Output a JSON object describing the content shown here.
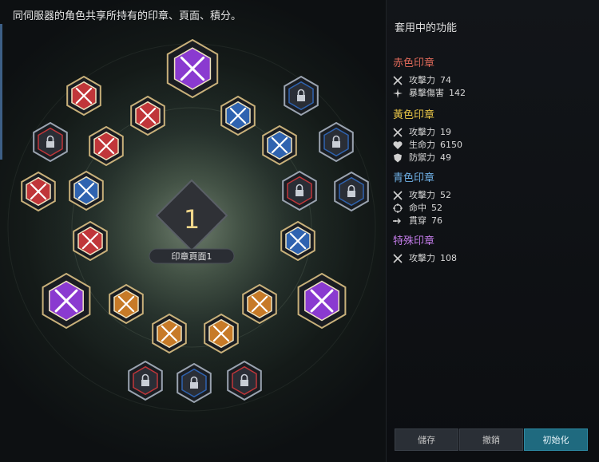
{
  "header": {
    "description": "同伺服器的角色共享所持有的印章、頁面、積分。"
  },
  "center": {
    "page_number": "1",
    "page_label": "印章頁面1"
  },
  "panel": {
    "title": "套用中的功能",
    "sections": [
      {
        "title": "赤色印章",
        "color": "#e06a5a",
        "stats": [
          {
            "icon": "crossed-swords-icon",
            "name": "攻擊力",
            "value": "74"
          },
          {
            "icon": "critical-icon",
            "name": "暴擊傷害",
            "value": "142"
          }
        ]
      },
      {
        "title": "黃色印章",
        "color": "#e8c547",
        "stats": [
          {
            "icon": "crossed-swords-icon",
            "name": "攻擊力",
            "value": "19"
          },
          {
            "icon": "heart-icon",
            "name": "生命力",
            "value": "6150"
          },
          {
            "icon": "shield-icon",
            "name": "防禦力",
            "value": "49"
          }
        ]
      },
      {
        "title": "青色印章",
        "color": "#6fb0e6",
        "stats": [
          {
            "icon": "crossed-swords-icon",
            "name": "攻擊力",
            "value": "52"
          },
          {
            "icon": "crosshair-icon",
            "name": "命中",
            "value": "52"
          },
          {
            "icon": "pierce-icon",
            "name": "貫穿",
            "value": "76"
          }
        ]
      },
      {
        "title": "特殊印章",
        "color": "#c27be8",
        "stats": [
          {
            "icon": "crossed-swords-icon",
            "name": "攻擊力",
            "value": "108"
          }
        ]
      }
    ]
  },
  "buttons": {
    "save": "儲存",
    "unlock": "撤銷",
    "reset": "初始化"
  },
  "colors": {
    "red": "#c0363a",
    "orange": "#c77a28",
    "blue": "#2f63b0",
    "purple": "#8a3ad0",
    "locked": "#3b3f48"
  },
  "slots": [
    {
      "name": "special",
      "kind": "special",
      "color": "purple"
    },
    {
      "name": "red",
      "kind": "sword",
      "color": "red"
    },
    {
      "name": "red",
      "kind": "sword",
      "color": "red"
    },
    {
      "name": "blue",
      "kind": "sword",
      "color": "blue"
    },
    {
      "name": "locked",
      "kind": "lock",
      "color": "blue"
    },
    {
      "name": "locked",
      "kind": "lock",
      "color": "red"
    },
    {
      "name": "red",
      "kind": "sword",
      "color": "red"
    },
    {
      "name": "blue",
      "kind": "sword",
      "color": "blue"
    },
    {
      "name": "locked",
      "kind": "lock",
      "color": "blue"
    },
    {
      "name": "red",
      "kind": "sword",
      "color": "red"
    },
    {
      "name": "blue",
      "kind": "sword",
      "color": "blue"
    },
    {
      "name": "locked",
      "kind": "lock",
      "color": "red"
    },
    {
      "name": "locked",
      "kind": "lock",
      "color": "blue"
    },
    {
      "name": "red",
      "kind": "sword",
      "color": "red"
    },
    {
      "name": "blue",
      "kind": "sword",
      "color": "blue"
    },
    {
      "name": "special",
      "kind": "special",
      "color": "purple"
    },
    {
      "name": "special",
      "kind": "special",
      "color": "purple"
    },
    {
      "name": "orange",
      "kind": "sword",
      "color": "orange"
    },
    {
      "name": "orange",
      "kind": "sword",
      "color": "orange"
    },
    {
      "name": "orange",
      "kind": "sword",
      "color": "orange"
    },
    {
      "name": "orange",
      "kind": "sword",
      "color": "orange"
    },
    {
      "name": "locked",
      "kind": "lock",
      "color": "red"
    },
    {
      "name": "locked",
      "kind": "lock",
      "color": "blue"
    },
    {
      "name": "locked",
      "kind": "lock",
      "color": "red"
    }
  ]
}
